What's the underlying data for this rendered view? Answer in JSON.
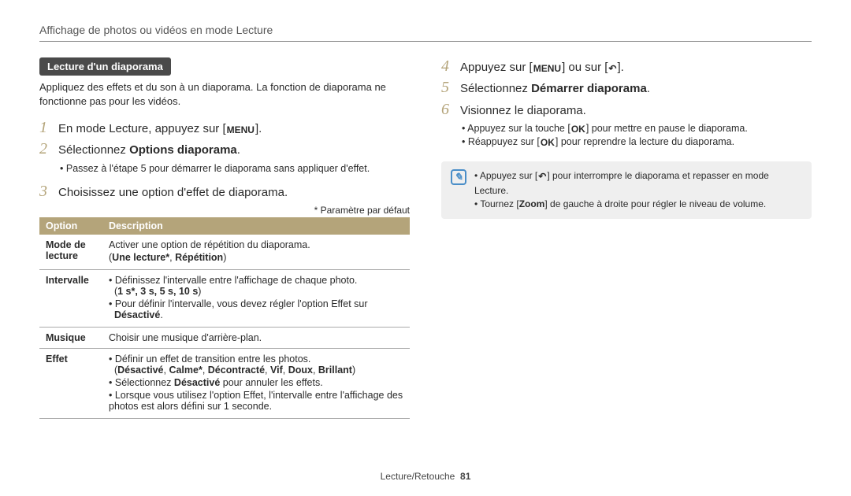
{
  "header": "Affichage de photos ou vidéos en mode Lecture",
  "section_chip": "Lecture d'un diaporama",
  "intro": "Appliquez des effets et du son à un diaporama. La fonction de diaporama ne fonctionne pas pour les vidéos.",
  "keys": {
    "menu": "MENU",
    "ok": "OK",
    "back": "↶",
    "zoom": "Zoom"
  },
  "steps_left": {
    "1": {
      "pre": "En mode Lecture, appuyez sur [",
      "post": "]."
    },
    "2": {
      "pre": "Sélectionnez ",
      "bold": "Options diaporama",
      "post": ".",
      "sub": "Passez à l'étape 5 pour démarrer le diaporama sans appliquer d'effet."
    },
    "3": {
      "text": "Choisissez une option d'effet de diaporama."
    }
  },
  "param_note": "* Paramètre par défaut",
  "table": {
    "head_option": "Option",
    "head_desc": "Description",
    "rows": [
      {
        "name": "Mode de lecture",
        "lines": [
          {
            "text": "Activer une option de répétition du diaporama."
          },
          {
            "paren_open": "(",
            "bold": "Une lecture*",
            "sep": ", ",
            "bold2": "Répétition",
            "paren_close": ")"
          }
        ]
      },
      {
        "name": "Intervalle",
        "lines": [
          {
            "bullet": true,
            "text": "Définissez l'intervalle entre l'affichage de chaque photo.",
            "subline_paren_open": "(",
            "subline_bold": "1 s*",
            "subline_rest": ", 3 s, 5 s, 10 s",
            "subline_paren_close": ")"
          },
          {
            "bullet": true,
            "text_pre": "Pour définir l'intervalle, vous devez régler l'option Effet sur ",
            "bold": "Désactivé",
            "text_post": "."
          }
        ]
      },
      {
        "name": "Musique",
        "lines": [
          {
            "text": "Choisir une musique d'arrière-plan."
          }
        ]
      },
      {
        "name": "Effet",
        "lines": [
          {
            "bullet": true,
            "text": "Définir un effet de transition entre les photos.",
            "subline_paren_open": "(",
            "subline_bold": "Désactivé",
            "subline_rest": ", ",
            "subline_bold2": "Calme*",
            "subline_rest2": ", ",
            "subline_bold3": "Décontracté",
            "subline_rest3": ", ",
            "subline_bold4": "Vif",
            "subline_rest4": ", ",
            "subline_bold5": "Doux",
            "subline_rest5": ", ",
            "subline_bold6": "Brillant",
            "subline_paren_close": ")"
          },
          {
            "bullet": true,
            "text_pre": "Sélectionnez ",
            "bold": "Désactivé",
            "text_post": " pour annuler les effets."
          },
          {
            "bullet": true,
            "text": "Lorsque vous utilisez l'option Effet, l'intervalle entre l'affichage des photos est alors défini sur 1 seconde."
          }
        ]
      }
    ]
  },
  "steps_right": {
    "4": {
      "pre": "Appuyez sur [",
      "mid": "] ou sur [",
      "post": "]."
    },
    "5": {
      "pre": "Sélectionnez ",
      "bold": "Démarrer diaporama",
      "post": "."
    },
    "6": {
      "text": "Visionnez le diaporama.",
      "sub1_pre": "Appuyez sur la touche [",
      "sub1_post": "] pour mettre en pause le diaporama.",
      "sub2_pre": "Réappuyez sur [",
      "sub2_post": "] pour reprendre la lecture du diaporama."
    }
  },
  "tips": {
    "1_pre": "Appuyez sur [",
    "1_post": "] pour interrompre le diaporama et repasser en mode Lecture.",
    "2_pre": "Tournez [",
    "2_bold": "Zoom",
    "2_post": "] de gauche à droite pour régler le niveau de volume."
  },
  "footer": {
    "section": "Lecture/Retouche",
    "page": "81"
  }
}
